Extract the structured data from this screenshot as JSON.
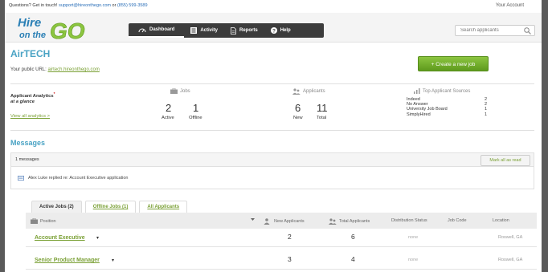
{
  "top_bar": {
    "contact_prefix": "Questions? Get in touch!",
    "email": "support@hireonthego.com",
    "or_text": "or",
    "phone": "(855) 599-3589",
    "account": "Your Account"
  },
  "logo": {
    "line1": "Hire",
    "line2": "on the",
    "go": "GO"
  },
  "nav": [
    {
      "label": "Dashboard",
      "icon": "gauge-icon"
    },
    {
      "label": "Activity",
      "icon": "list-icon"
    },
    {
      "label": "Reports",
      "icon": "document-icon"
    },
    {
      "label": "Help",
      "icon": "help-icon"
    }
  ],
  "search": {
    "placeholder": "Search applicants"
  },
  "company": {
    "name": "AirTECH",
    "public_url_label": "Your public URL:",
    "public_url": "airtech.hireonthego.com"
  },
  "create_job_label": "+ Create a new job",
  "analytics": {
    "title": "Applicant Analytics",
    "asterisk": "*",
    "subtitle": "at a glance",
    "view_all": "View all analytics >",
    "jobs": {
      "label": "Jobs",
      "active": "2",
      "active_label": "Active",
      "offline": "1",
      "offline_label": "Offline"
    },
    "applicants": {
      "label": "Applicants",
      "new": "6",
      "new_label": "New",
      "total": "11",
      "total_label": "Total"
    },
    "sources": {
      "label": "Top Applicant Sources",
      "items": [
        {
          "name": "Indeed",
          "count": "2"
        },
        {
          "name": "No Answer",
          "count": "2"
        },
        {
          "name": "University Job Board",
          "count": "1"
        },
        {
          "name": "SimplyHired",
          "count": "1"
        }
      ]
    }
  },
  "messages": {
    "title": "Messages",
    "count_label": "1 messages",
    "mark_all": "Mark all as read",
    "items": [
      {
        "text": "Alex Luke replied re: Account Executive application"
      }
    ]
  },
  "tabs": [
    {
      "label": "Active Jobs (2)"
    },
    {
      "label": "Offline Jobs (1)"
    },
    {
      "label": "All Applicants"
    }
  ],
  "table": {
    "headers": {
      "position": "Position",
      "new_applicants": "New Applicants",
      "total_applicants": "Total Applicants",
      "status": "Distribution Status",
      "code": "Job Code",
      "location": "Location"
    },
    "rows": [
      {
        "position": "Account Executive",
        "new": "2",
        "total": "6",
        "status": "none",
        "location": "Roswell, GA"
      },
      {
        "position": "Senior Product Manager",
        "new": "3",
        "total": "4",
        "status": "none",
        "location": "Roswell, GA"
      }
    ]
  }
}
